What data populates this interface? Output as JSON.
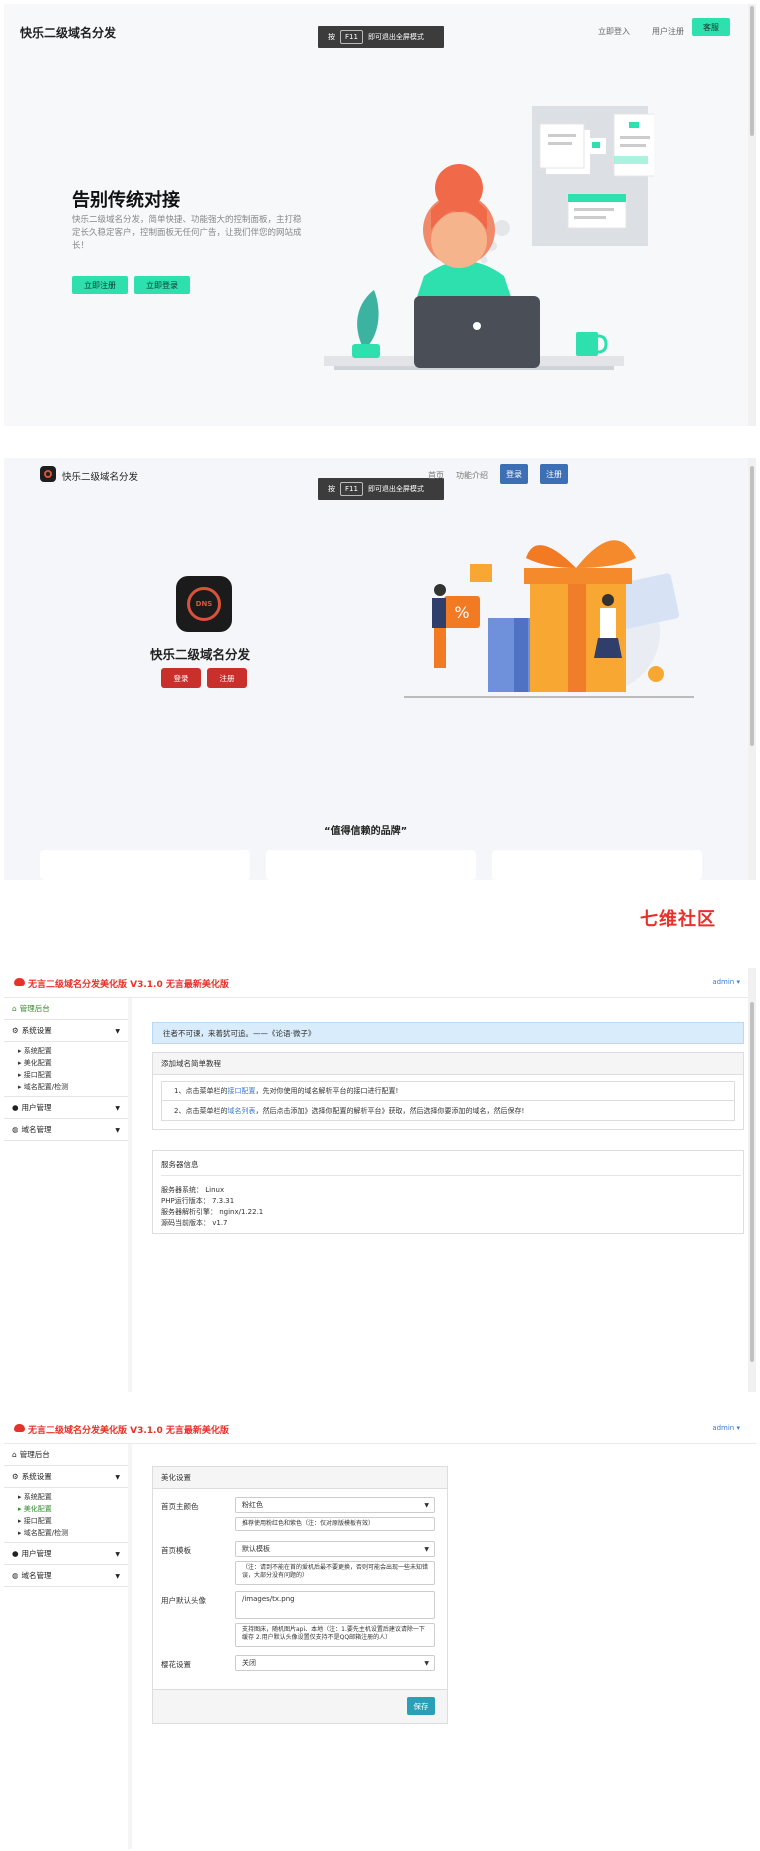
{
  "shot1": {
    "brand": "快乐二级域名分发",
    "nav": {
      "login": "立即登入",
      "register": "用户注册",
      "service": "客服"
    },
    "f11": {
      "press": "按",
      "key": "F11",
      "exit": "即可退出全屏模式"
    },
    "hero": {
      "title": "告别传统对接",
      "desc": "快乐二级域名分发，简单快捷、功能强大的控制面板，主打稳定长久稳定客户，控制面板无任何广告，让我们伴您的网站成长！",
      "register_btn": "立即注册",
      "login_btn": "立即登录"
    }
  },
  "shot2": {
    "brand": "快乐二级域名分发",
    "nav": {
      "home": "首页",
      "features": "功能介绍",
      "login": "登录",
      "register": "注册"
    },
    "f11": {
      "press": "按",
      "key": "F11",
      "exit": "即可退出全屏模式"
    },
    "logo_text": "DNS",
    "title": "快乐二级域名分发",
    "login_btn": "登录",
    "register_btn": "注册",
    "trusted": "“值得信赖的品牌”"
  },
  "watermark": "七维社区",
  "shot3": {
    "app_title": "无言二级域名分发美化版 V3.1.0 无言最新美化版",
    "user": "admin",
    "sidebar": {
      "dashboard": "管理后台",
      "system": "系统设置",
      "subs": [
        "系统配置",
        "美化配置",
        "接口配置",
        "域名配置/检测"
      ],
      "users": "用户管理",
      "domains": "域名管理"
    },
    "notice": "往者不可谏，来着犹可追。——《论语·微子》",
    "tutorial": {
      "title": "添加域名简单教程",
      "step1_a": "1、点击菜单栏的",
      "step1_link": "接口配置",
      "step1_b": "，先对你使用的域名解析平台的接口进行配置!",
      "step2_a": "2、点击菜单栏的",
      "step2_link": "域名列表",
      "step2_b": "，然后点击添加》选择你配置的解析平台》获取，然后选择你要添加的域名，然后保存!"
    },
    "server": {
      "title": "服务器信息",
      "rows": [
        {
          "k": "服务器系统：",
          "v": "Linux"
        },
        {
          "k": "PHP运行版本：",
          "v": "7.3.31"
        },
        {
          "k": "服务器解析引擎：",
          "v": "nginx/1.22.1"
        },
        {
          "k": "源码当前版本：",
          "v": "v1.7"
        }
      ]
    }
  },
  "shot4": {
    "app_title": "无言二级域名分发美化版 V3.1.0 无言最新美化版",
    "user": "admin",
    "sidebar": {
      "dashboard": "管理后台",
      "system": "系统设置",
      "subs": [
        "系统配置",
        "美化配置",
        "接口配置",
        "域名配置/检测"
      ],
      "users": "用户管理",
      "domains": "域名管理"
    },
    "panel_title": "美化设置",
    "fields": {
      "theme_label": "首页主颜色",
      "theme_value": "粉红色",
      "theme_help": "推荐使用粉红色和紫色（注：仅对原版模板有效）",
      "template_label": "首页模板",
      "template_value": "默认模板",
      "template_help": "（注：请到不能在首的爱机后最不要更换，否则可能会出现一些未知错误，大部分没有问题的）",
      "avatar_label": "用户默认头像",
      "avatar_value": "/images/tx.png",
      "avatar_help": "支持图床，随机图片api、本地（注：1.要先主机设置后建议请除一下缓存 2.用户默认头像设置仅支持不是QQ邮箱注册的人）",
      "sakura_label": "樱花设置",
      "sakura_value": "关闭"
    },
    "save": "保存"
  },
  "colors": {
    "teal": "#2ee0ae",
    "brand_red": "#e8312b",
    "link_blue": "#3a7cd3",
    "btn_red": "#c9302c",
    "nav_blue": "#3c6fb4"
  }
}
